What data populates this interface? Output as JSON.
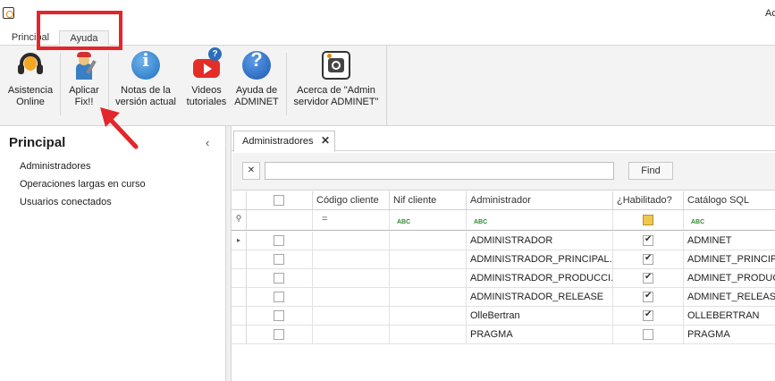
{
  "window": {
    "title": "Ac"
  },
  "ribbon_tabs": [
    {
      "label": "Principal"
    },
    {
      "label": "Ayuda",
      "active": true
    }
  ],
  "ribbon_buttons": [
    {
      "line1": "Asistencia",
      "line2": "Online",
      "icon": "headset-support-icon"
    },
    {
      "line1": "Aplicar",
      "line2": "Fix!!",
      "icon": "repairman-icon"
    },
    {
      "line1": "Notas de la",
      "line2": "versión actual",
      "icon": "info-icon"
    },
    {
      "line1": "Videos",
      "line2": "tutoriales",
      "icon": "youtube-icon"
    },
    {
      "line1": "Ayuda de",
      "line2": "ADMINET",
      "icon": "help-icon"
    },
    {
      "line1": "Acerca de \"Admin",
      "line2": "servidor ADMINET\"",
      "icon": "adminet-logo-icon"
    }
  ],
  "left_panel": {
    "title": "Principal",
    "collapse_glyph": "‹",
    "items": [
      {
        "label": "Administradores"
      },
      {
        "label": "Operaciones largas en curso"
      },
      {
        "label": "Usuarios conectados"
      }
    ]
  },
  "document": {
    "tab_label": "Administradores",
    "tab_close": "✕"
  },
  "search": {
    "clear_glyph": "✕",
    "value": "",
    "placeholder": "",
    "find_label": "Find"
  },
  "grid": {
    "columns": [
      "Código cliente",
      "Nif cliente",
      "Administrador",
      "¿Habilitado?",
      "Catálogo SQL"
    ],
    "filter": {
      "codigo": "=",
      "abc": "ABC"
    },
    "row_indicator": "▸",
    "rows": [
      {
        "selected": false,
        "codigo": "",
        "nif": "",
        "administrador": "ADMINISTRADOR",
        "habilitado": true,
        "catalogo": "ADMINET"
      },
      {
        "selected": false,
        "codigo": "",
        "nif": "",
        "administrador": "ADMINISTRADOR_PRINCIPAL...",
        "habilitado": true,
        "catalogo": "ADMINET_PRINCIPA"
      },
      {
        "selected": false,
        "codigo": "",
        "nif": "",
        "administrador": "ADMINISTRADOR_PRODUCCI...",
        "habilitado": true,
        "catalogo": "ADMINET_PRODUCC"
      },
      {
        "selected": false,
        "codigo": "",
        "nif": "",
        "administrador": "ADMINISTRADOR_RELEASE",
        "habilitado": true,
        "catalogo": "ADMINET_RELEASE"
      },
      {
        "selected": false,
        "codigo": "",
        "nif": "",
        "administrador": "OlleBertran",
        "habilitado": true,
        "catalogo": "OLLEBERTRAN"
      },
      {
        "selected": false,
        "codigo": "",
        "nif": "",
        "administrador": "PRAGMA",
        "habilitado": false,
        "catalogo": "PRAGMA"
      }
    ]
  },
  "annotations": {
    "highlight_color": "#e3262c",
    "arrow_color": "#e3262c"
  }
}
